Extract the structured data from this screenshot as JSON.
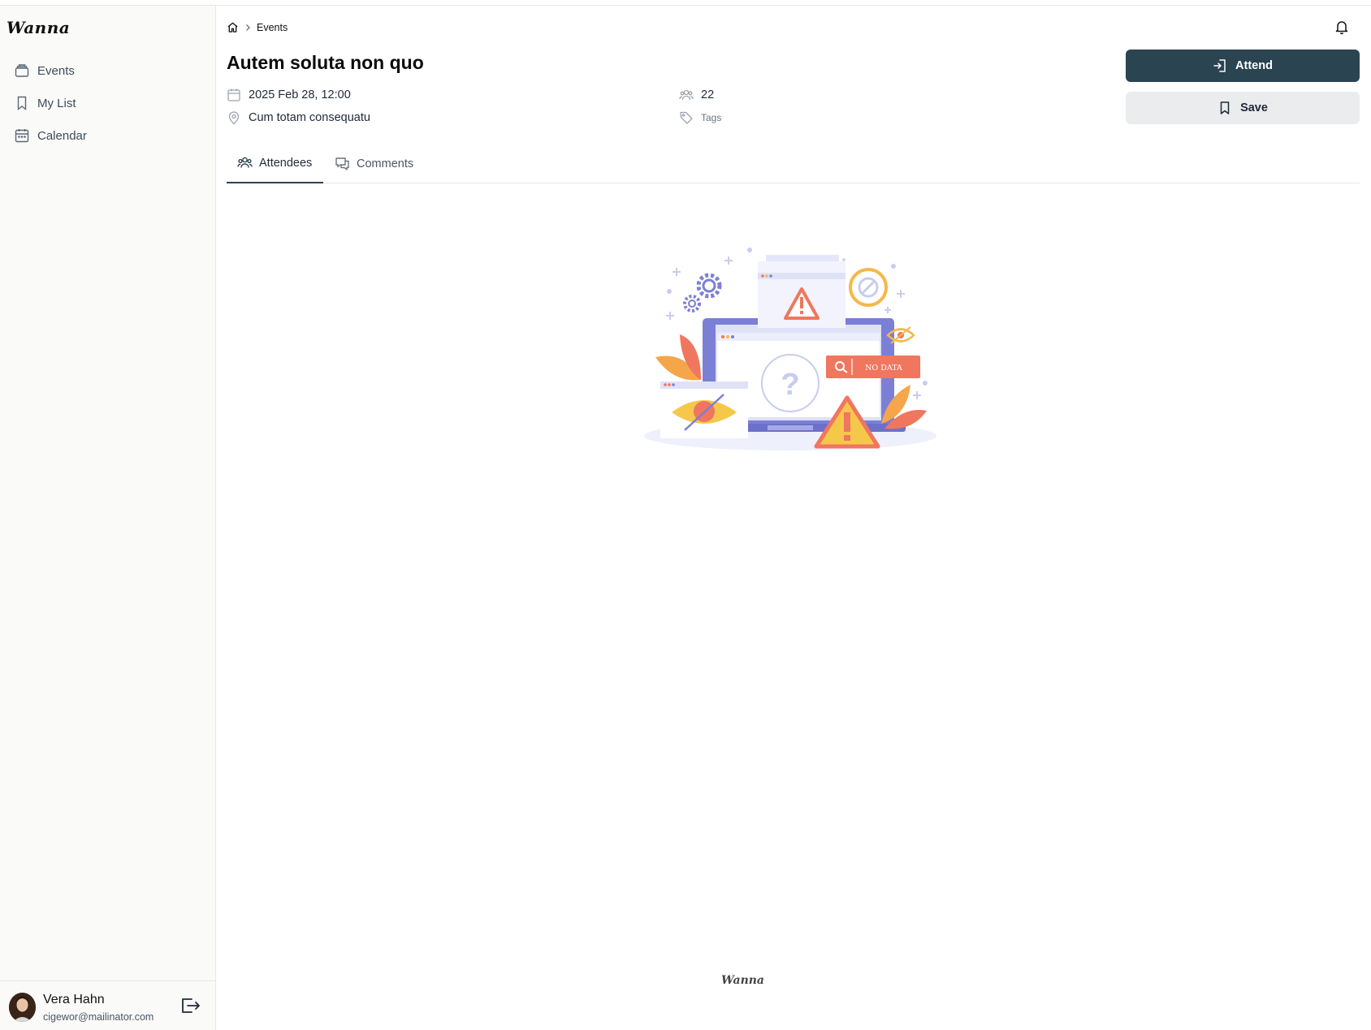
{
  "app": {
    "logo": "Wanna",
    "footer_logo": "Wanna"
  },
  "sidebar": {
    "items": [
      {
        "label": "Events",
        "icon": "layers-icon"
      },
      {
        "label": "My List",
        "icon": "bookmark-icon"
      },
      {
        "label": "Calendar",
        "icon": "calendar-icon"
      }
    ]
  },
  "user": {
    "name": "Vera Hahn",
    "email": "cigewor@mailinator.com"
  },
  "breadcrumb": {
    "current": "Events"
  },
  "event": {
    "title": "Autem soluta non quo",
    "datetime": "2025 Feb 28, 12:00",
    "location": "Cum totam consequatu",
    "attendees_count": "22",
    "tags_label": "Tags"
  },
  "actions": {
    "attend_label": "Attend",
    "save_label": "Save"
  },
  "tabs": [
    {
      "label": "Attendees",
      "active": true
    },
    {
      "label": "Comments",
      "active": false
    }
  ],
  "empty_state": {
    "badge_text": "NO DATA"
  },
  "colors": {
    "primary": "#2a4451",
    "illustration_purple": "#7b7fd6",
    "illustration_orange": "#f0765f"
  }
}
